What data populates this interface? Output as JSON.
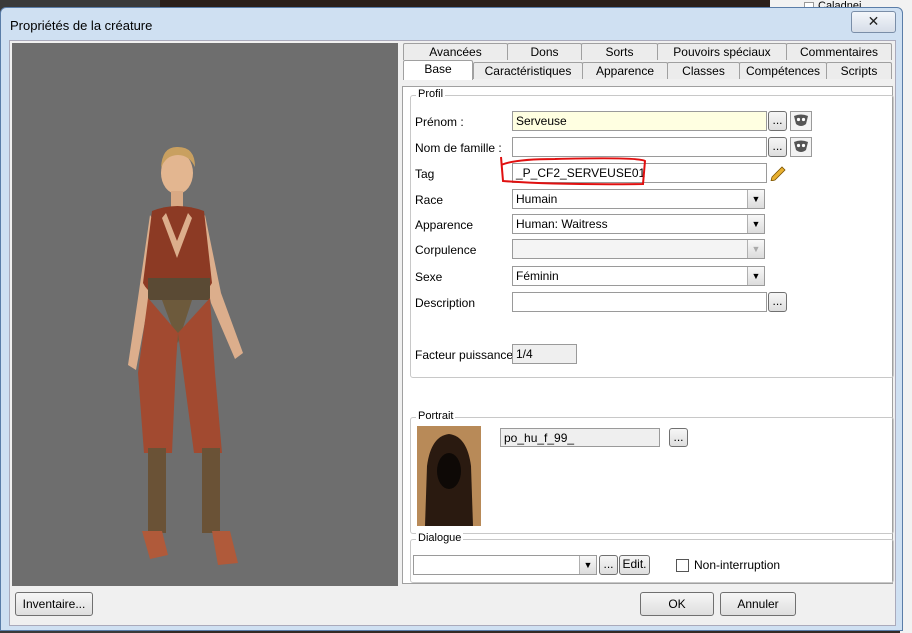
{
  "window": {
    "title": "Propriétés de la créature",
    "close_glyph": "✕"
  },
  "background": {
    "right_item": "Caladnei"
  },
  "tabs": {
    "row1": [
      "Avancées",
      "Dons",
      "Sorts",
      "Pouvoirs spéciaux",
      "Commentaires"
    ],
    "row2": [
      "Base",
      "Caractéristiques",
      "Apparence",
      "Classes",
      "Compétences",
      "Scripts"
    ],
    "active": "Base"
  },
  "profil": {
    "legend": "Profil",
    "prenom": {
      "label": "Prénom :",
      "value": "Serveuse"
    },
    "nom_famille": {
      "label": "Nom de famille :",
      "value": ""
    },
    "tag": {
      "label": "Tag",
      "value": "_P_CF2_SERVEUSE01"
    },
    "race": {
      "label": "Race",
      "value": "Humain"
    },
    "apparence": {
      "label": "Apparence",
      "value": "Human: Waitress"
    },
    "corpulence": {
      "label": "Corpulence",
      "value": ""
    },
    "sexe": {
      "label": "Sexe",
      "value": "Féminin"
    },
    "description": {
      "label": "Description",
      "value": ""
    },
    "facteur": {
      "label": "Facteur puissance",
      "value": "1/4"
    },
    "browse_label": "..."
  },
  "portrait": {
    "legend": "Portrait",
    "value": "po_hu_f_99_",
    "browse_label": "..."
  },
  "dialogue": {
    "legend": "Dialogue",
    "value": "",
    "browse_label": "...",
    "edit_label": "Edit.",
    "non_interruption_label": "Non-interruption",
    "non_interruption_checked": false
  },
  "footer": {
    "inventaire": "Inventaire...",
    "ok": "OK",
    "annuler": "Annuler"
  },
  "colors": {
    "annotation": "#e01010",
    "preview_bg": "#6e6e6e",
    "highlight_field": "#ffffe1"
  }
}
